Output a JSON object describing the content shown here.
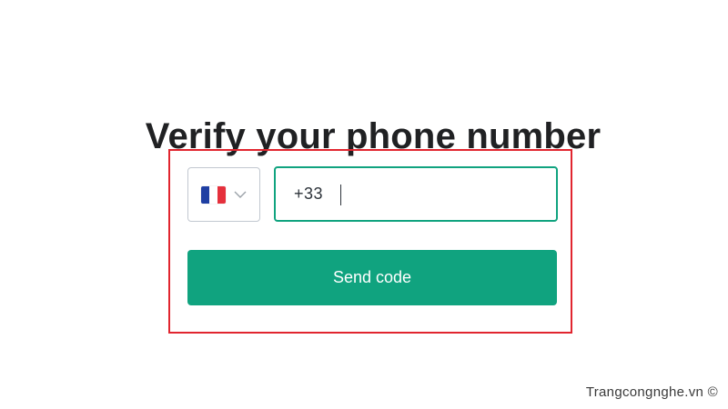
{
  "page": {
    "title": "Verify your phone number"
  },
  "phone_form": {
    "country": {
      "flag_icon": "france-flag-icon",
      "dropdown_icon": "chevron-down-icon"
    },
    "phone_field": {
      "value": "+33 "
    },
    "send_button_label": "Send code"
  },
  "watermark": "Trangcongnghe.vn ©",
  "colors": {
    "accent": "#10a37f",
    "highlight_border": "#e1252f",
    "title_text": "#202123",
    "button_text": "#ffffff"
  }
}
